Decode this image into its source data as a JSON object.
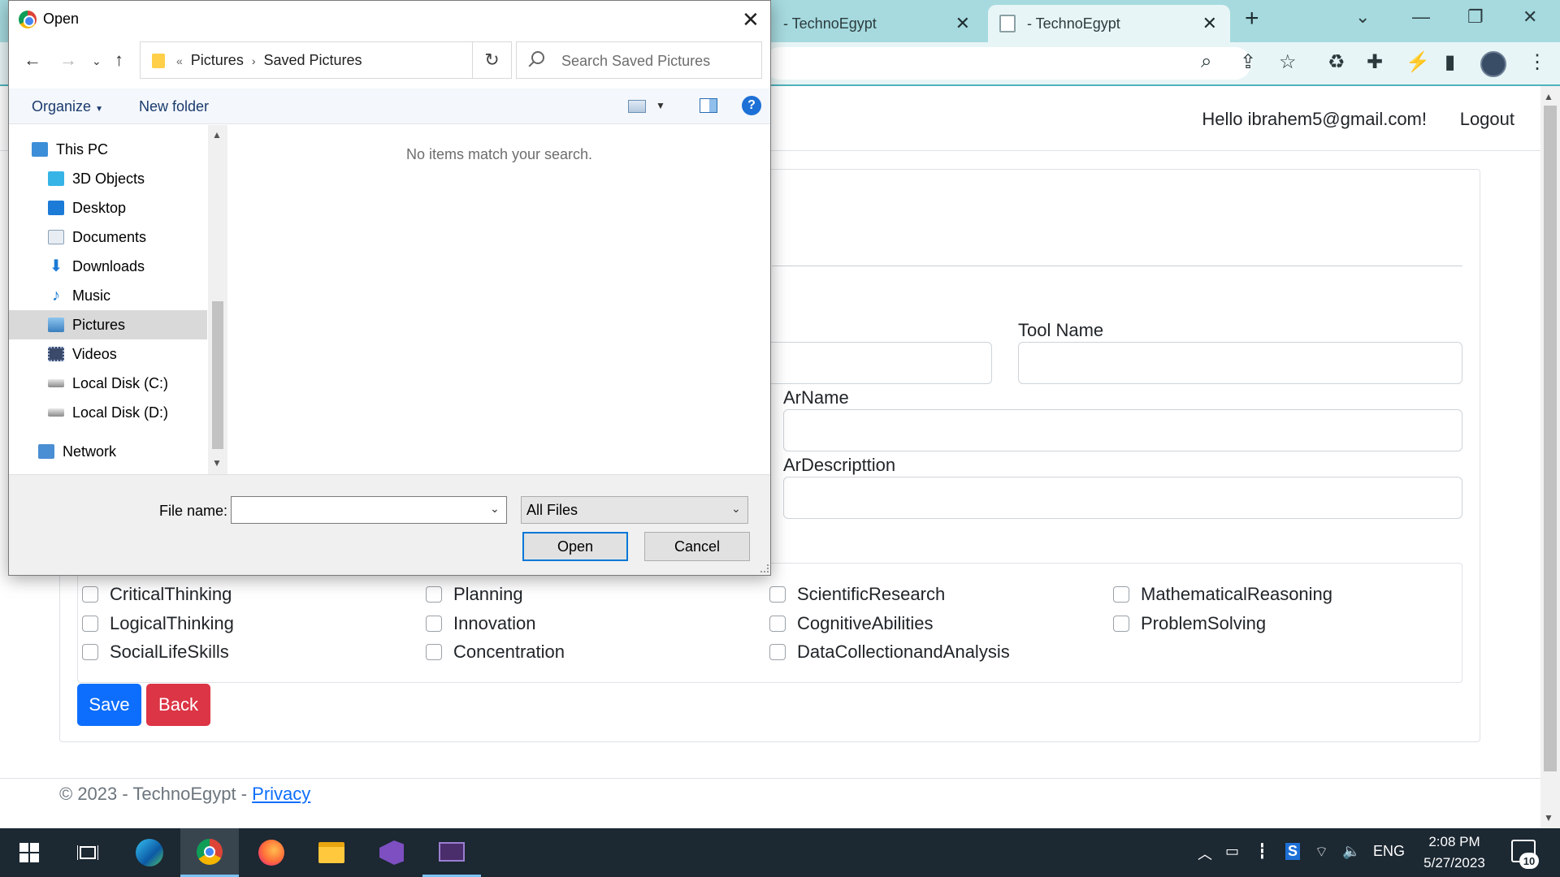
{
  "browser": {
    "tabs": [
      {
        "label": "- TechnoEgypt"
      },
      {
        "label": "- TechnoEgypt"
      }
    ]
  },
  "page": {
    "navbar": {
      "greeting": "Hello ibrahem5@gmail.com!",
      "logout": "Logout"
    },
    "form": {
      "tool_name_label": "Tool Name",
      "arname_label": "ArName",
      "ardescription_label": "ArDescripttion"
    },
    "skills": [
      "CriticalThinking",
      "Planning",
      "ScientificResearch",
      "MathematicalReasoning",
      "LogicalThinking",
      "Innovation",
      "CognitiveAbilities",
      "ProblemSolving",
      "SocialLifeSkills",
      "Concentration",
      "DataCollectionandAnalysis"
    ],
    "buttons": {
      "save": "Save",
      "back": "Back"
    },
    "footer": {
      "text": "© 2023 - TechnoEgypt - ",
      "privacy": "Privacy"
    }
  },
  "dialog": {
    "title": "Open",
    "breadcrumb": [
      "Pictures",
      "Saved Pictures"
    ],
    "search_placeholder": "Search Saved Pictures",
    "commands": {
      "organize": "Organize",
      "new_folder": "New folder"
    },
    "nav_items": [
      {
        "label": "This PC",
        "icon": "computer-icon"
      },
      {
        "label": "3D Objects",
        "icon": "cube-icon"
      },
      {
        "label": "Desktop",
        "icon": "desktop-icon"
      },
      {
        "label": "Documents",
        "icon": "document-icon"
      },
      {
        "label": "Downloads",
        "icon": "download-icon"
      },
      {
        "label": "Music",
        "icon": "music-icon"
      },
      {
        "label": "Pictures",
        "icon": "pictures-icon",
        "selected": true
      },
      {
        "label": "Videos",
        "icon": "video-icon"
      },
      {
        "label": "Local Disk (C:)",
        "icon": "drive-icon"
      },
      {
        "label": "Local Disk (D:)",
        "icon": "drive-icon"
      },
      {
        "label": "Network",
        "icon": "network-icon"
      }
    ],
    "empty_message": "No items match your search.",
    "file_name_label": "File name:",
    "file_name_value": "",
    "file_type": "All Files",
    "open_button": "Open",
    "cancel_button": "Cancel"
  },
  "taskbar": {
    "language": "ENG",
    "time": "2:08 PM",
    "date": "5/27/2023",
    "notification_count": "10"
  }
}
